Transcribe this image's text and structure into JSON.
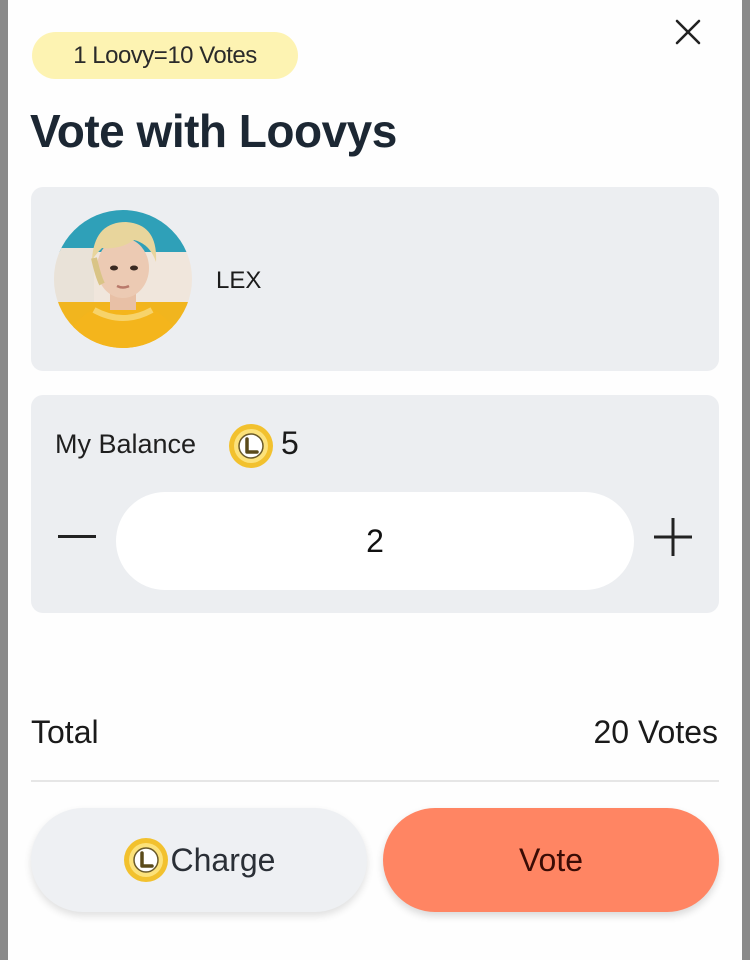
{
  "rate_badge": "1 Loovy=10 Votes",
  "title": "Vote with Loovys",
  "artist": {
    "name": "LEX",
    "avatar": "artist-photo"
  },
  "balance": {
    "label": "My Balance",
    "value": "5",
    "coin_icon": "loovy-coin-icon"
  },
  "quantity": {
    "value": "2",
    "decrement_icon": "minus-icon",
    "increment_icon": "plus-icon"
  },
  "total": {
    "label": "Total",
    "value": "20 Votes"
  },
  "buttons": {
    "charge_label": "Charge",
    "vote_label": "Vote"
  },
  "colors": {
    "badge_bg": "#fdf3b2",
    "card_bg": "#eceef1",
    "vote_accent": "#ff8563",
    "coin": "#f2c12e"
  }
}
